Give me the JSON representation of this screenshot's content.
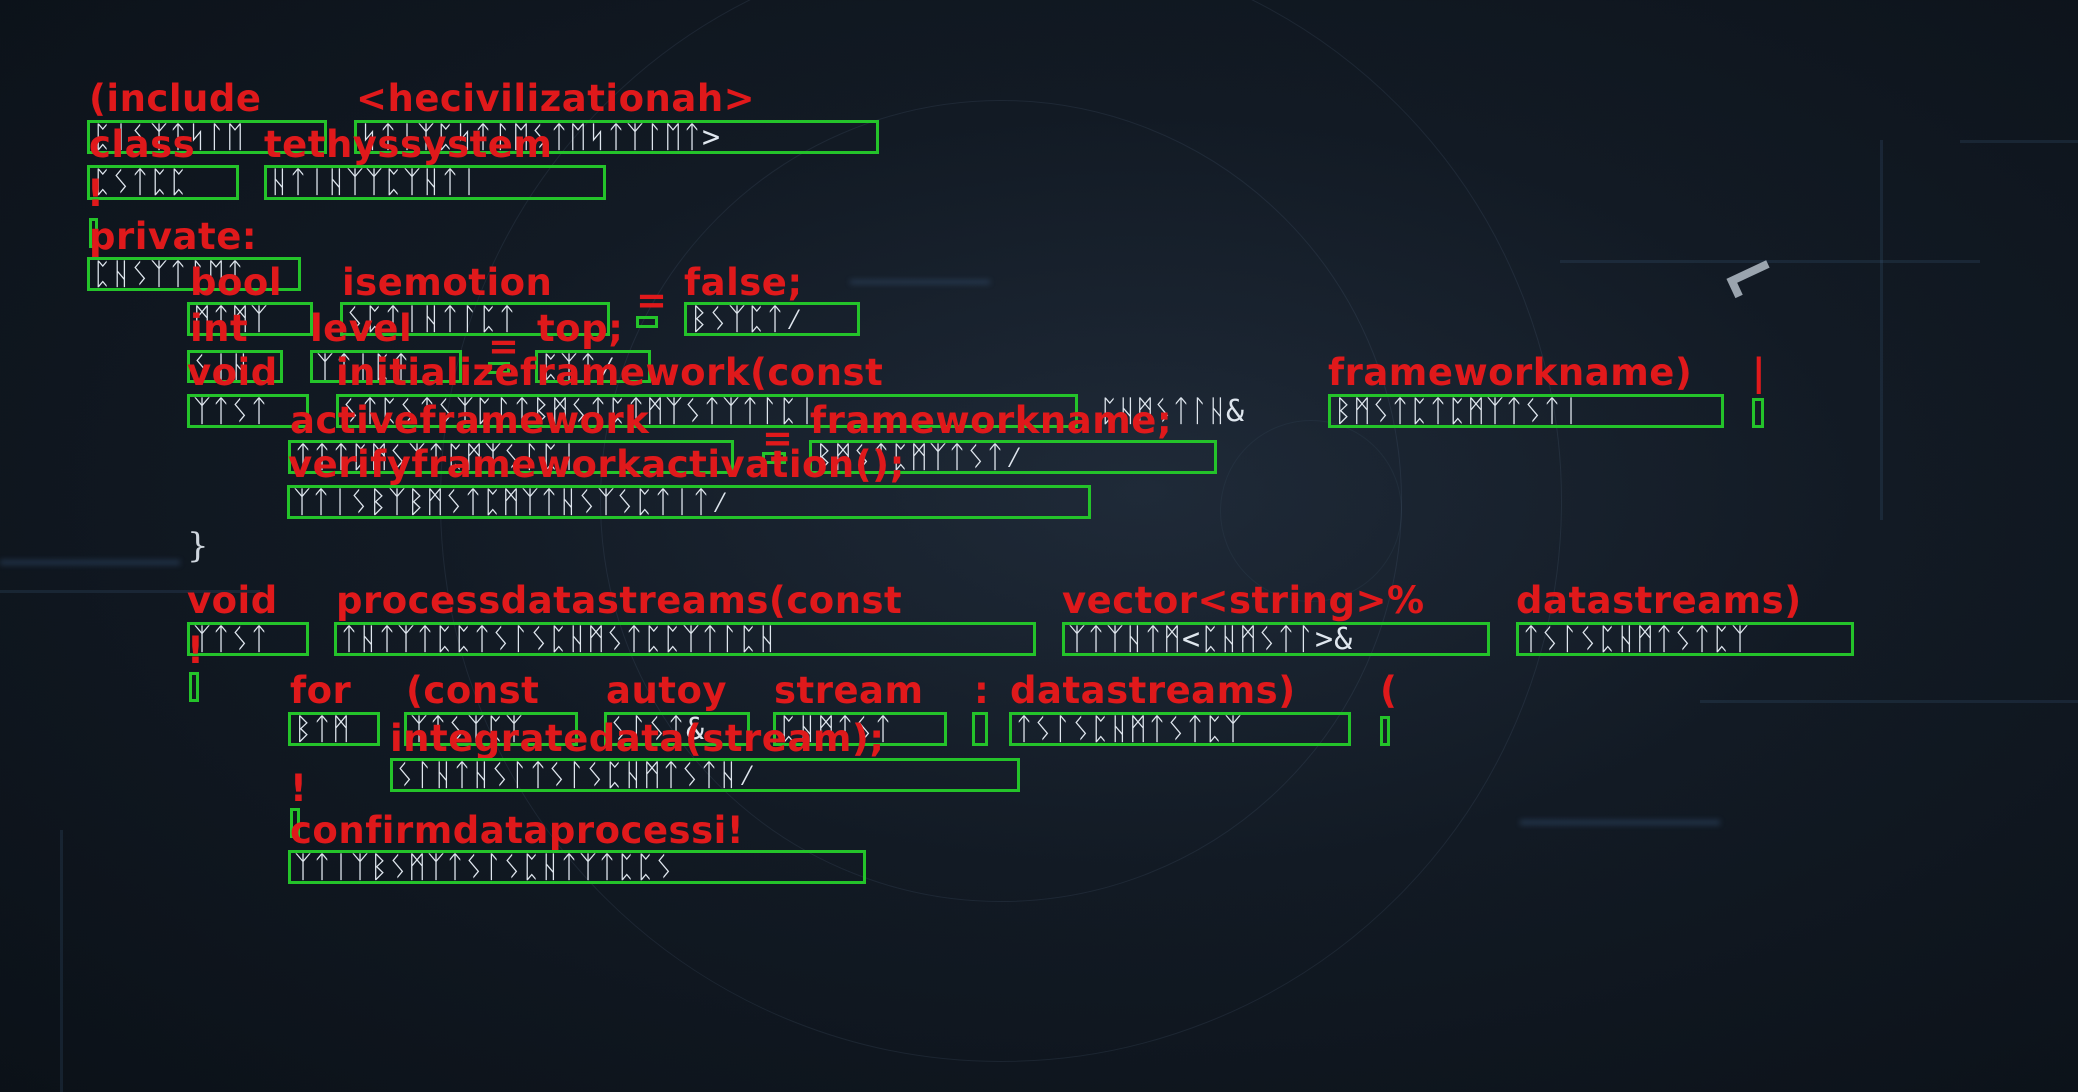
{
  "labels": {
    "l1a": "(include",
    "l1b": "<hecivilizationah>",
    "l2a": "class",
    "l2b": "tethyssystem",
    "l3": "!",
    "l4": "private:",
    "l5a": "bool",
    "l5b": "isemotion",
    "l5c": "=",
    "l5d": "false;",
    "l6a": "int",
    "l6b": "level",
    "l6c": "=",
    "l6d": "top;",
    "l7a": "void",
    "l7b": "initializeframework(const",
    "l7c": "frameworkname)",
    "l7d": "|",
    "l8a": "activeframework",
    "l8b": "=",
    "l8c": "frameworkname;",
    "l9": "verifyframeworkactivation();",
    "l10a": "void",
    "l10b": "processdatastreams(const",
    "l10c": "vector<string>%",
    "l10d": "datastreams)",
    "l11": "!",
    "l12a": "for",
    "l12b": "(const",
    "l12c": "autoy",
    "l12d": "stream",
    "l12e": ":",
    "l12f": "datastreams)",
    "l12g": "(",
    "l13": "integratedata(stream);",
    "l14": "!",
    "l15": "confirmdataprocessi!"
  },
  "glyphs": {
    "g1a": "ᛈᛁᛊᛉᛏᛋᛚᛖ",
    "g1b": "ᛋᛏᛁᛉᛈᛋᛏᛚᛖᛊᛏᛖᛋᛏᛉᛚᛖᛏ>",
    "g2a": "ᛈᛊᛏᛈᛈ",
    "g2b": "ᚺᛏᛁᚺᛉᛉᛈᛉᚺᛏᛁ",
    "g4": "ᛈᚺᛊᛉᛏᛚᛖᛏ",
    "g5a": "ᛗᛏᛗᛉ",
    "g5b": "ᛊᛈᛏᛁᚺᛏᛚᛈᛏ",
    "g5c": "-",
    "g5d": "ᛒᛊᛉᛈᛏ⁄",
    "g6a": "ᛊᛁᚺ",
    "g6b": "ᛉᛏᛁᛈᛏ",
    "g6c": "-",
    "g6d": "ᛈᛉᛏ⁄",
    "g7a": "ᛉᛏᛊᛏ",
    "g7b": "ᛊᛏᛈᛊᛏᛊᛉᛈᛚᛏᛒᛗᛊᛏᛈᛏᛗᛉᛊᛏᛉᛏᛚᛈᛁ",
    "g7plain": "ᛈᚺᛗᛊᛏᛚᚺ&",
    "g7c": "ᛒᛗᛊᛏᛈᛏᛈᛗᛉᛏᛊᛏᛁ",
    "g7d": "¦",
    "g8a": "ᛏᛏᛏᛈᛗᛊᛉᛏᛈᛗᛉᛊᛚᛈᛁ",
    "g8b": "-",
    "g8c": "ᛒᛗᛊᛏᛈᛗᛉᛏᛊᛏ⁄",
    "g9": "ᛉᛏᛁᛊᛒᛉᛒᛗᛊᛏᛈᛗᛉᛏᚺᛊᛉᛊᛈᛏᛁᛏ⁄",
    "g10a": "ᛉᛏᛊᛏ",
    "g10b": "ᛏᚺᛏᛉᛏᛈᛈᛏᛊᛚᛊᛈᚺᛗᛊᛏᛈᛈᛉᛏᛚᛈᚺ",
    "g10c": "ᛉᛏᛉᚺᛏᛗ<ᛈᚺᛗᛊᛏᛚ>&",
    "g10d": "ᛏᛊᛚᛊᛈᚺᛗᛏᛊᛏᛈᛉ",
    "g11": "¦",
    "g12a": "ᛒᛏᛗ",
    "g12b": "ᛉᛏᛊᛉᛈᛉ",
    "g12c": "ᛊᛚᛊᛏ&",
    "g12d": "ᛈᚺᛗᛏᛊᛏ",
    "g12e": "¦",
    "g12f": "ᛏᛊᛚᛊᛈᚺᛗᛏᛊᛏᛈᛉ",
    "g12g": "¦",
    "g13": "ᛊᛚᚺᛏᚺᛊᛚᛏᛊᛚᛊᛈᚺᛗᛏᛊᛏᚺ⁄",
    "g14": "¦",
    "g15": "ᛉᛏᛁᛉᛒᛊᛗᛉᛏᛊᛚᛊᛈᚺᛏᛉᛏᛈᛈᛊ"
  },
  "closing_brace": "}",
  "colors": {
    "label": "#e0191b",
    "box": "#24c32a",
    "background": "#121a24"
  }
}
